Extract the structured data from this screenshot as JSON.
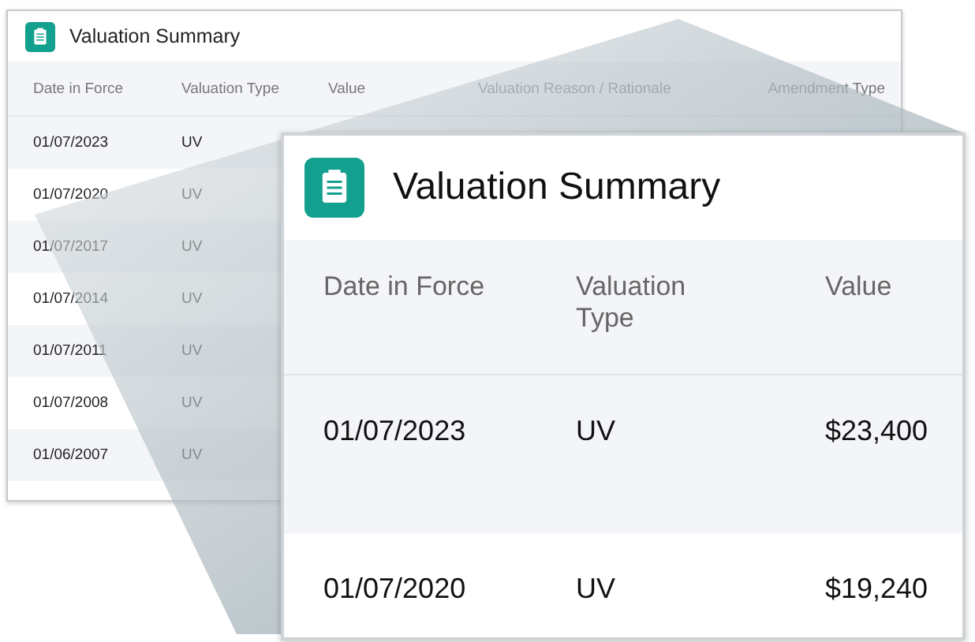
{
  "card": {
    "title": "Valuation Summary",
    "columns": [
      "Date in Force",
      "Valuation Type",
      "Value",
      "Valuation Reason / Rationale",
      "Amendment Type"
    ],
    "rows": [
      {
        "date": "01/07/2023",
        "type": "UV"
      },
      {
        "date": "01/07/2020",
        "type": "UV"
      },
      {
        "date": "01/07/2017",
        "type": "UV"
      },
      {
        "date": "01/07/2014",
        "type": "UV"
      },
      {
        "date": "01/07/2011",
        "type": "UV"
      },
      {
        "date": "01/07/2008",
        "type": "UV"
      },
      {
        "date": "01/06/2007",
        "type": "UV"
      }
    ]
  },
  "magnified": {
    "title": "Valuation Summary",
    "columns": [
      "Date in Force",
      "Valuation Type",
      "Value"
    ],
    "rows": [
      {
        "date": "01/07/2023",
        "type": "UV",
        "value": "$23,400"
      },
      {
        "date": "01/07/2020",
        "type": "UV",
        "value": "$19,240"
      }
    ]
  }
}
